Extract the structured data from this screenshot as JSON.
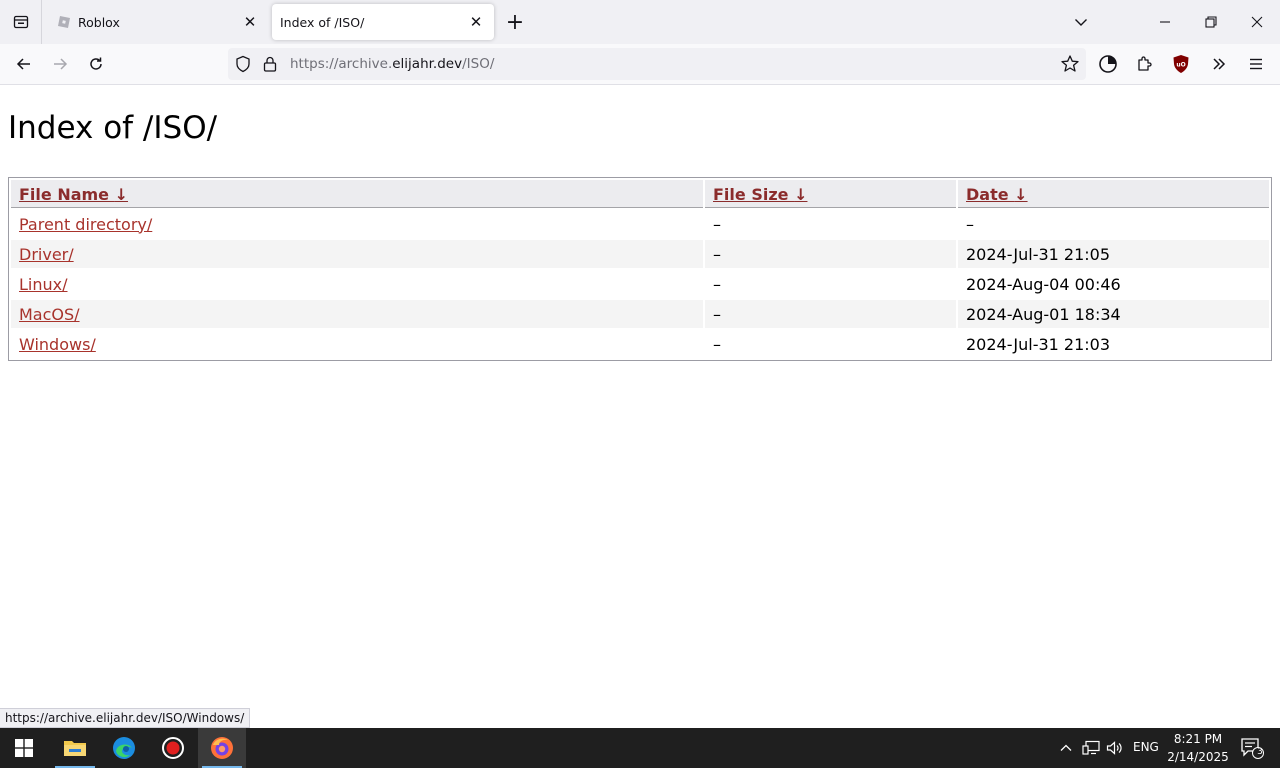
{
  "browser": {
    "tabs": [
      {
        "title": "Roblox",
        "active": false
      },
      {
        "title": "Index of /ISO/",
        "active": true
      }
    ],
    "url": {
      "prefix": "https://archive.",
      "domain": "elijahr.dev",
      "path": "/ISO/"
    }
  },
  "page": {
    "heading": "Index of /ISO/",
    "columns": [
      "File Name ",
      "File Size ",
      "Date "
    ],
    "sort_glyph": "↓",
    "rows": [
      {
        "name": "Parent directory/",
        "size": "–",
        "date": "–"
      },
      {
        "name": "Driver/",
        "size": "–",
        "date": "2024-Jul-31 21:05"
      },
      {
        "name": "Linux/",
        "size": "–",
        "date": "2024-Aug-04 00:46"
      },
      {
        "name": "MacOS/",
        "size": "–",
        "date": "2024-Aug-01 18:34"
      },
      {
        "name": "Windows/",
        "size": "–",
        "date": "2024-Jul-31 21:03"
      }
    ]
  },
  "status_link": "https://archive.elijahr.dev/ISO/Windows/",
  "taskbar": {
    "language": "ENG",
    "time": "8:21 PM",
    "date": "2/14/2025",
    "notification_count": "3"
  },
  "colors": {
    "link": "#a8332c",
    "header_link": "#8b2c2c",
    "taskbar": "#1f1f1f",
    "accent": "#76b9ed"
  }
}
